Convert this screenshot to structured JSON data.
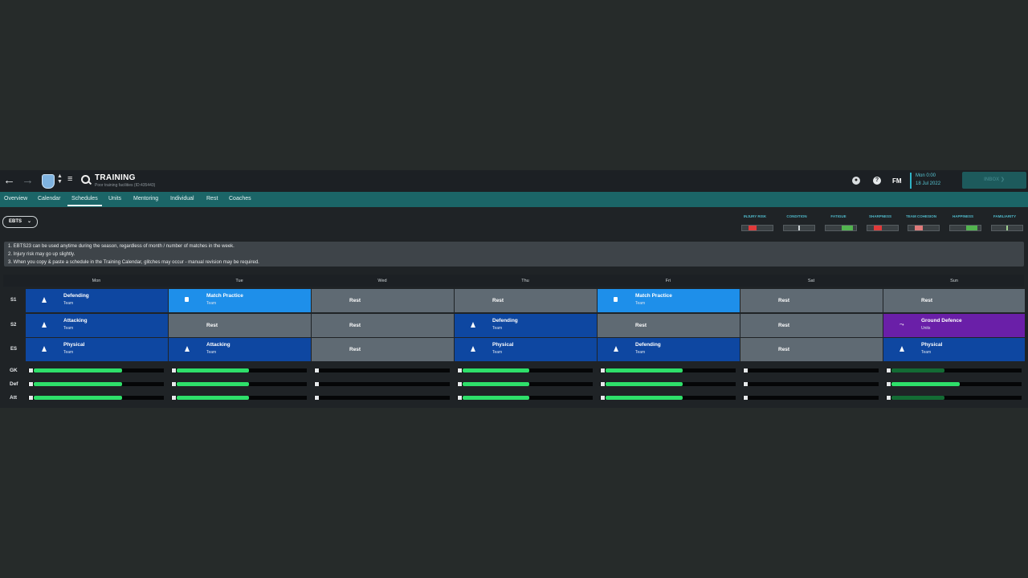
{
  "header": {
    "title": "TRAINING",
    "subtitle": "Poor training facilities (ID:435443)",
    "fm_logo": "FM",
    "date_line1": "Mon 0:00",
    "date_line2": "18 Jul 2022",
    "inbox_label": "INBOX"
  },
  "tabs": [
    "Overview",
    "Calendar",
    "Schedules",
    "Units",
    "Mentoring",
    "Individual",
    "Rest",
    "Coaches"
  ],
  "active_tab": "Schedules",
  "schedule_selector": {
    "value": "EBTS",
    "icon": "chevron-down-icon"
  },
  "indicators": [
    {
      "label": "INJURY RISK",
      "level": "low",
      "color": "#e03a3a"
    },
    {
      "label": "CONDITION",
      "level": "medium",
      "color": "#cfd5d8"
    },
    {
      "label": "FATIGUE",
      "level": "high",
      "color": "#52b44f"
    },
    {
      "label": "SHARPNESS",
      "level": "low",
      "color": "#e03a3a"
    },
    {
      "label": "TEAM COHESION",
      "level": "low",
      "color": "#e07a7a"
    },
    {
      "label": "HAPPINESS",
      "level": "high",
      "color": "#52b44f"
    },
    {
      "label": "FAMILIARITY",
      "level": "medium",
      "color": "#9fd08f"
    }
  ],
  "notes": [
    "1. EBTS23 can be used anytime during the season, regardless of month / number of matches in the week.",
    "2. Injury risk may go up slightly.",
    "3. When you copy & paste a schedule in the Training Calendar, glitches may occur - manual revision may be required."
  ],
  "days": [
    "Mon",
    "Tue",
    "Wed",
    "Thu",
    "Fri",
    "Sat",
    "Sun"
  ],
  "rows": [
    {
      "label": "S1",
      "cells": [
        {
          "name": "Defending",
          "sub": "Team",
          "type": "session",
          "icon": "cone-icon",
          "color": "#0e47a1"
        },
        {
          "name": "Match Practice",
          "sub": "Team",
          "type": "session",
          "icon": "clipboard-icon",
          "color": "#1e8fea"
        },
        {
          "name": "Rest",
          "sub": "",
          "type": "rest",
          "icon": "",
          "color": "#5f6a73"
        },
        {
          "name": "Rest",
          "sub": "",
          "type": "rest",
          "icon": "",
          "color": "#5f6a73"
        },
        {
          "name": "Match Practice",
          "sub": "Team",
          "type": "session",
          "icon": "clipboard-icon",
          "color": "#1e8fea"
        },
        {
          "name": "Rest",
          "sub": "",
          "type": "rest",
          "icon": "",
          "color": "#5f6a73"
        },
        {
          "name": "Rest",
          "sub": "",
          "type": "rest",
          "icon": "",
          "color": "#5f6a73"
        }
      ]
    },
    {
      "label": "S2",
      "cells": [
        {
          "name": "Attacking",
          "sub": "Team",
          "type": "session",
          "icon": "cone-icon",
          "color": "#0e47a1"
        },
        {
          "name": "Rest",
          "sub": "",
          "type": "rest",
          "icon": "",
          "color": "#5f6a73"
        },
        {
          "name": "Rest",
          "sub": "",
          "type": "rest",
          "icon": "",
          "color": "#5f6a73"
        },
        {
          "name": "Defending",
          "sub": "Team",
          "type": "session",
          "icon": "cone-icon",
          "color": "#0e47a1"
        },
        {
          "name": "Rest",
          "sub": "",
          "type": "rest",
          "icon": "",
          "color": "#5f6a73"
        },
        {
          "name": "Rest",
          "sub": "",
          "type": "rest",
          "icon": "",
          "color": "#5f6a73"
        },
        {
          "name": "Ground Defence",
          "sub": "Units",
          "type": "session",
          "icon": "boot-icon",
          "color": "#6a1fa8"
        }
      ]
    },
    {
      "label": "ES",
      "cells": [
        {
          "name": "Physical",
          "sub": "Team",
          "type": "session",
          "icon": "cone-icon",
          "color": "#0e47a1"
        },
        {
          "name": "Attacking",
          "sub": "Team",
          "type": "session",
          "icon": "cone-icon",
          "color": "#0e47a1"
        },
        {
          "name": "Rest",
          "sub": "",
          "type": "rest",
          "icon": "",
          "color": "#5f6a73"
        },
        {
          "name": "Physical",
          "sub": "Team",
          "type": "session",
          "icon": "cone-icon",
          "color": "#0e47a1"
        },
        {
          "name": "Defending",
          "sub": "Team",
          "type": "session",
          "icon": "cone-icon",
          "color": "#0e47a1"
        },
        {
          "name": "Rest",
          "sub": "",
          "type": "rest",
          "icon": "",
          "color": "#5f6a73"
        },
        {
          "name": "Physical",
          "sub": "Team",
          "type": "session",
          "icon": "cone-icon",
          "color": "#0e47a1"
        }
      ]
    }
  ],
  "workload": [
    {
      "label": "GK",
      "values": [
        0.65,
        0.53,
        0,
        0.49,
        0.57,
        0,
        0.39
      ],
      "colors": [
        "#2ee06a",
        "#2ee06a",
        "#2ee06a",
        "#2ee06a",
        "#2ee06a",
        "#2ee06a",
        "#136b34"
      ]
    },
    {
      "label": "Def",
      "values": [
        0.65,
        0.53,
        0,
        0.49,
        0.57,
        0,
        0.5
      ],
      "colors": [
        "#2ee06a",
        "#2ee06a",
        "#2ee06a",
        "#2ee06a",
        "#2ee06a",
        "#2ee06a",
        "#2ee06a"
      ]
    },
    {
      "label": "Att",
      "values": [
        0.65,
        0.53,
        0,
        0.49,
        0.57,
        0,
        0.39
      ],
      "colors": [
        "#2ee06a",
        "#2ee06a",
        "#2ee06a",
        "#2ee06a",
        "#2ee06a",
        "#2ee06a",
        "#136b34"
      ]
    }
  ]
}
